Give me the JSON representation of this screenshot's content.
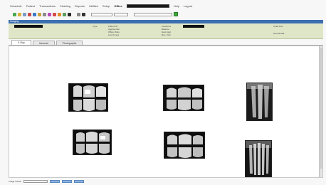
{
  "menu": {
    "items": [
      "Schedule",
      "Patient",
      "Transactions",
      "Charting",
      "Reports",
      "Utilities",
      "Setup",
      "Office"
    ],
    "after_office": [
      "Help",
      "Logout"
    ]
  },
  "window": {
    "title": "Imaging"
  },
  "patient_info": {
    "labels": [
      "Type",
      "Patient ID",
      "Age/Gender",
      "Office Visits",
      "Last X-rays",
      "Insurance",
      "Balance",
      "Next Appt",
      "Rec. Visit",
      "Chart Due",
      "Next Recall"
    ]
  },
  "tabs": [
    {
      "label": "X-Ray"
    },
    {
      "label": "Intraoral"
    },
    {
      "label": "Photographs"
    }
  ],
  "xrays": [
    {
      "name": "xray-bitewing-1",
      "kind": "bitewing"
    },
    {
      "name": "xray-bitewing-2",
      "kind": "bitewing"
    },
    {
      "name": "xray-periapical-1",
      "kind": "periapical"
    },
    {
      "name": "xray-bitewing-3",
      "kind": "bitewing"
    },
    {
      "name": "xray-bitewing-4",
      "kind": "bitewing"
    },
    {
      "name": "xray-periapical-2",
      "kind": "periapical"
    }
  ],
  "status": {
    "label": "Image Viewer"
  },
  "colors": {
    "title_bar": "#3c6fb0",
    "info_panel": "#dfe6c8",
    "go_button": "#3ea83a"
  },
  "icons": [
    "new-icon",
    "save-icon",
    "print-icon",
    "import-icon",
    "scan-icon",
    "zoom-icon",
    "rotate-icon",
    "contrast-icon",
    "delete-icon",
    "go-icon"
  ]
}
